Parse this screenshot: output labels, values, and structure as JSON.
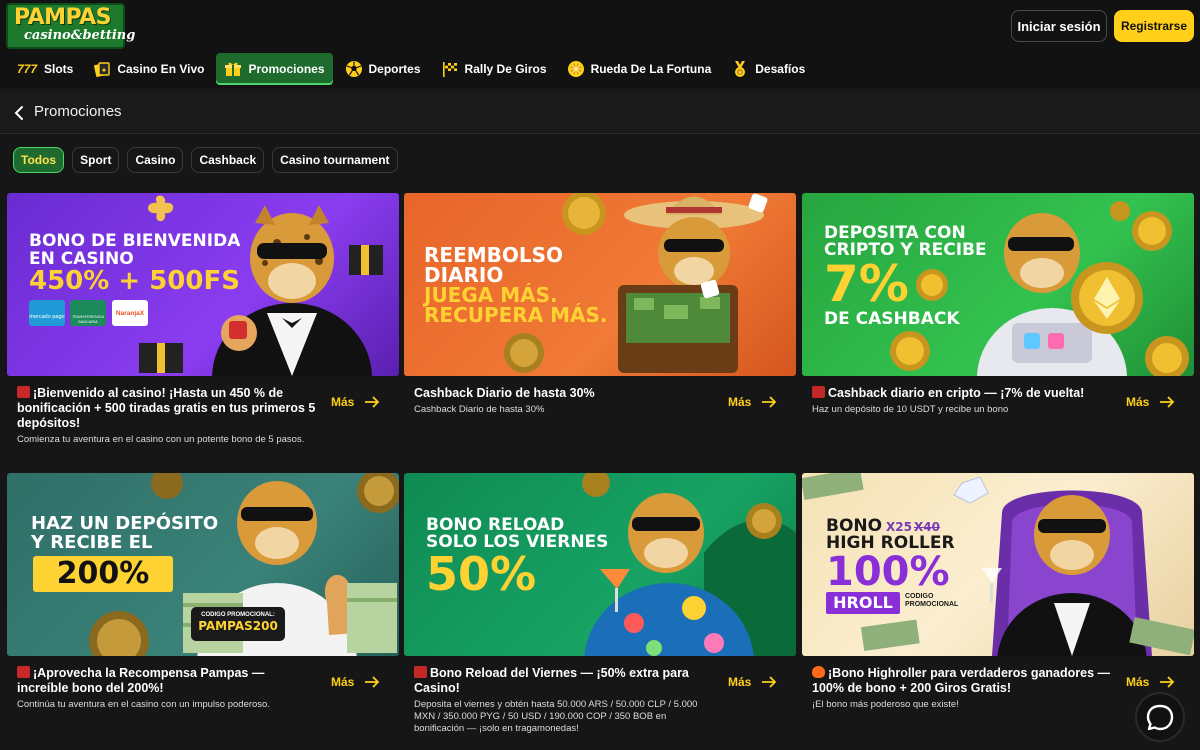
{
  "brand": {
    "name_line1": "PAMPAS",
    "name_line2": "casino&betting"
  },
  "auth": {
    "login_label": "Iniciar sesión",
    "register_label": "Registrarse"
  },
  "nav": [
    {
      "label": "Slots",
      "icon": "slots-777-icon"
    },
    {
      "label": "Casino En Vivo",
      "icon": "live-casino-icon"
    },
    {
      "label": "Promociones",
      "icon": "gift-icon",
      "active": true
    },
    {
      "label": "Deportes",
      "icon": "soccer-ball-icon"
    },
    {
      "label": "Rally De Giros",
      "icon": "checkered-flag-icon"
    },
    {
      "label": "Rueda De La Fortuna",
      "icon": "fortune-wheel-icon"
    },
    {
      "label": "Desafíos",
      "icon": "medal-icon"
    }
  ],
  "page": {
    "title": "Promociones"
  },
  "filters": [
    {
      "label": "Todos",
      "active": true
    },
    {
      "label": "Sport"
    },
    {
      "label": "Casino"
    },
    {
      "label": "Cashback"
    },
    {
      "label": "Casino tournament"
    }
  ],
  "promos": [
    {
      "banner": {
        "lines": [
          "BONO DE BIENVENIDA",
          "EN CASINO",
          "450% + 500FS"
        ],
        "badges": [
          "mercado pago",
          "TRANSFERENCIA BANCARIA",
          "NaranjaX"
        ]
      },
      "title": "¡Bienvenido al casino! ¡Hasta un 450 % de bonificación + 500 tiradas gratis en tus primeros 5 depósitos!",
      "description": "Comienza tu aventura en el casino con un potente bono de 5 pasos.",
      "more_label": "Más"
    },
    {
      "banner": {
        "lines": [
          "REEMBOLSO",
          "DIARIO",
          "JUEGA MÁS.",
          "RECUPERA MÁS."
        ]
      },
      "title": "Cashback Diario de hasta 30%",
      "description": "Cashback Diario de hasta 30%",
      "more_label": "Más"
    },
    {
      "banner": {
        "lines": [
          "DEPOSITA CON",
          "CRIPTO Y RECIBE",
          "7%",
          "DE CASHBACK"
        ]
      },
      "title": "Cashback diario en cripto — ¡7% de vuelta!",
      "description": "Haz un depósito de 10 USDT y recibe un bono",
      "more_label": "Más"
    },
    {
      "banner": {
        "lines": [
          "HAZ UN DEPÓSITO",
          "Y RECIBE EL",
          "200%"
        ],
        "promo_label": "CODIGO PROMOCIONAL:",
        "promo_code": "PAMPAS200"
      },
      "title": "¡Aprovecha la Recompensa Pampas — increíble bono del 200%!",
      "description": "Continúa tu aventura en el casino con un impulso poderoso.",
      "more_label": "Más"
    },
    {
      "banner": {
        "lines": [
          "BONO RELOAD",
          "SOLO LOS VIERNES",
          "50%"
        ]
      },
      "title": "Bono Reload del Viernes — ¡50% extra para Casino!",
      "description": "Deposita el viernes y obtén hasta 50.000 ARS / 50.000 CLP / 5.000 MXN / 350.000 PYG / 50 USD / 190.000 COP / 350 BOB en bonificación — ¡solo en tragamonedas!",
      "more_label": "Más"
    },
    {
      "banner": {
        "lines": [
          "BONO",
          "HIGH ROLLER",
          "100%",
          "HROLL"
        ],
        "wager_new": "X25",
        "wager_old": "X40",
        "promo_label": "CODIGO PROMOCIONAL"
      },
      "title": "¡Bono Highroller para verdaderos ganadores — 100% de bono + 200 Giros Gratis!",
      "description": "¡El bono más poderoso que existe!",
      "more_label": "Más"
    }
  ],
  "colors": {
    "accent": "#ffcf1a",
    "active_green": "#1f6b2d",
    "background": "#161616"
  }
}
